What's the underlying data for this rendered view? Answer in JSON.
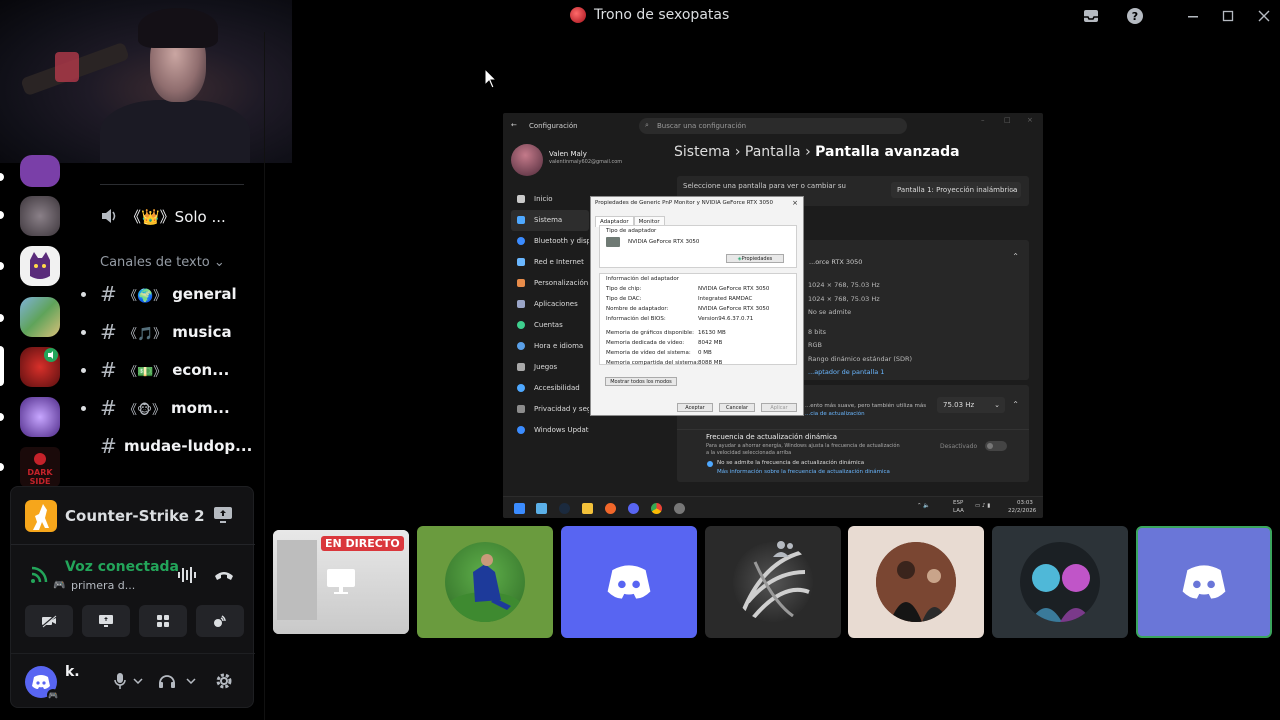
{
  "window": {
    "title": "Trono de sexopatas"
  },
  "channels": {
    "voice_channel": "《👑》Solo ...",
    "section_label": "Canales de texto",
    "text_channels": [
      {
        "emoji": "《🌍》",
        "name": "general"
      },
      {
        "emoji": "《🎵》",
        "name": "musica"
      },
      {
        "emoji": "《💵》",
        "name": "econ..."
      },
      {
        "emoji": "《🐵》",
        "name": "mom..."
      },
      {
        "emoji": "",
        "name": "mudae-ludop..."
      }
    ]
  },
  "activity": {
    "game_name": "Counter-Strike 2"
  },
  "voice": {
    "status": "Voz conectada",
    "channel": "primera d..."
  },
  "user": {
    "name": "k."
  },
  "stream": {
    "live_badge": "EN DIRECTO",
    "settings_title": "Configuración",
    "search_placeholder": "Buscar una configuración",
    "profile_name": "Valen Maly",
    "profile_email": "valentinmaly602@gmail.com",
    "nav": [
      "Inicio",
      "Sistema",
      "Bluetooth y dispo",
      "Red e Internet",
      "Personalización",
      "Aplicaciones",
      "Cuentas",
      "Hora e idioma",
      "Juegos",
      "Accesibilidad",
      "Privacidad y seg",
      "Windows Update"
    ],
    "breadcrumb": [
      "Sistema",
      "Pantalla",
      "Pantalla avanzada"
    ],
    "select_prompt": "Seleccione una pantalla para ver o cambiar su",
    "select_value": "Pantalla 1: Proyección inalámbrica",
    "display_info": {
      "adapter": "...orce RTX 3050",
      "values": [
        "1024 × 768, 75.03 Hz",
        "1024 × 768, 75.03 Hz",
        "No se admite",
        "8 bits",
        "RGB",
        "Rango dinámico estándar (SDR)"
      ],
      "adapter_link": "...aptador de pantalla 1"
    },
    "refresh": {
      "desc": "...ento más suave, pero también utiliza más",
      "link": "...cia de actualización",
      "rate": "75.03 Hz",
      "dynamic_title": "Frecuencia de actualización dinámica",
      "dynamic_desc1": "Para ayudar a ahorrar energía, Windows ajusta la frecuencia de actualización",
      "dynamic_desc2": "a la velocidad seleccionada arriba",
      "dynamic_state": "Desactivado",
      "dynamic_warn": "No se admite la frecuencia de actualización dinámica",
      "dynamic_more": "Más información sobre la frecuencia de actualización dinámica"
    },
    "dialog": {
      "title": "Propiedades de Generic PnP Monitor y NVIDIA GeForce RTX 3050",
      "tabs": [
        "Adaptador",
        "Monitor"
      ],
      "adapter_type_label": "Tipo de adaptador",
      "adapter_name": "NVIDIA GeForce RTX 3050",
      "properties_btn": "Propiedades",
      "info_label": "Información del adaptador",
      "rows": [
        {
          "k": "Tipo de chip:",
          "v": "NVIDIA GeForce RTX 3050"
        },
        {
          "k": "Tipo de DAC:",
          "v": "Integrated RAMDAC"
        },
        {
          "k": "Nombre de adaptador:",
          "v": "NVIDIA GeForce RTX 3050"
        },
        {
          "k": "Información del BIOS:",
          "v": "Version94.6.37.0.71"
        },
        {
          "k": "Memoria de gráficos disponible:",
          "v": "16130 MB"
        },
        {
          "k": "Memoria dedicada de vídeo:",
          "v": "8042 MB"
        },
        {
          "k": "Memoria de vídeo del sistema:",
          "v": "0 MB"
        },
        {
          "k": "Memoria compartida del sistema:",
          "v": "8088 MB"
        }
      ],
      "list_modes_btn": "Mostrar todos los modos",
      "ok": "Aceptar",
      "cancel": "Cancelar",
      "apply": "Aplicar"
    },
    "tray": {
      "lang1": "ESP",
      "lang2": "LAA",
      "time": "03:03",
      "date": "22/2/2026"
    }
  },
  "colors": {
    "blurple": "#5865f2",
    "green": "#23a55a",
    "live_red": "#da373c"
  }
}
